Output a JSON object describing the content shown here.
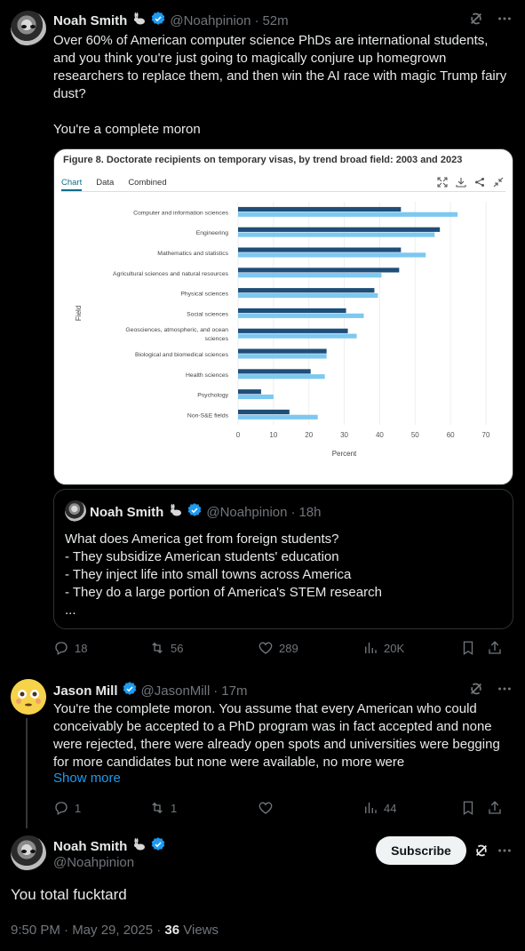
{
  "post1": {
    "name": "Noah Smith",
    "handle": "@Noahpinion",
    "time": "52m",
    "text": "Over 60% of American computer science PhDs are international students, and you think you're just going to magically conjure up homegrown researchers to replace them, and then win the AI race with magic Trump fairy dust?\n\nYou're a complete moron",
    "actions": {
      "replies": "18",
      "reposts": "56",
      "likes": "289",
      "views": "20K"
    }
  },
  "chart_data": {
    "type": "bar",
    "title": "Figure 8. Doctorate recipients on temporary visas, by trend broad field: 2003 and 2023",
    "tabs": [
      "Chart",
      "Data",
      "Combined"
    ],
    "active_tab": "Chart",
    "categories": [
      "Computer and information sciences",
      "Engineering",
      "Mathematics and statistics",
      "Agricultural sciences and natural resources",
      "Physical sciences",
      "Social sciences",
      "Geosciences, atmospheric, and ocean sciences",
      "Biological and biomedical sciences",
      "Health sciences",
      "Psychology",
      "Non-S&E fields"
    ],
    "series": [
      {
        "name": "2003",
        "color": "#1f4e79",
        "values": [
          46,
          57,
          46,
          45.5,
          38.5,
          30.5,
          31,
          25,
          20.5,
          6.5,
          14.5
        ]
      },
      {
        "name": "2023",
        "color": "#7dc8f0",
        "values": [
          62,
          55.5,
          53,
          40.5,
          39.5,
          35.5,
          33.5,
          25,
          24.5,
          10,
          22.5
        ]
      }
    ],
    "xlabel": "Percent",
    "ylabel": "Field",
    "xticks": [
      "0",
      "10",
      "20",
      "30",
      "40",
      "50",
      "60",
      "70"
    ],
    "xlim": [
      0,
      70
    ],
    "legend_position": "bottom"
  },
  "quote": {
    "name": "Noah Smith",
    "handle": "@Noahpinion",
    "time": "18h",
    "text": "What does America get from foreign students?\n- They subsidize American students' education\n- They inject life into small towns across America\n- They do a large portion of America's STEM research\n..."
  },
  "post2": {
    "name": "Jason Mill",
    "handle": "@JasonMill",
    "time": "17m",
    "text": "You're the complete moron. You assume that every American who could conceivably be accepted to a PhD program was in fact accepted and none were rejected, there were already open spots and universities were begging for more candidates but none were available, no more were",
    "show_more": "Show more",
    "actions": {
      "replies": "1",
      "reposts": "1",
      "likes": "",
      "views": "44"
    }
  },
  "post3": {
    "name": "Noah Smith",
    "handle": "@Noahpinion",
    "subscribe": "Subscribe",
    "text": "You total fucktard",
    "datetime": "9:50 PM · May 29, 2025 · ",
    "views_count": "36",
    "views_label": " Views"
  },
  "colors": {
    "background": "#000000",
    "accent": "#1d9bf0",
    "muted": "#71767b",
    "text": "#e7e9ea"
  }
}
